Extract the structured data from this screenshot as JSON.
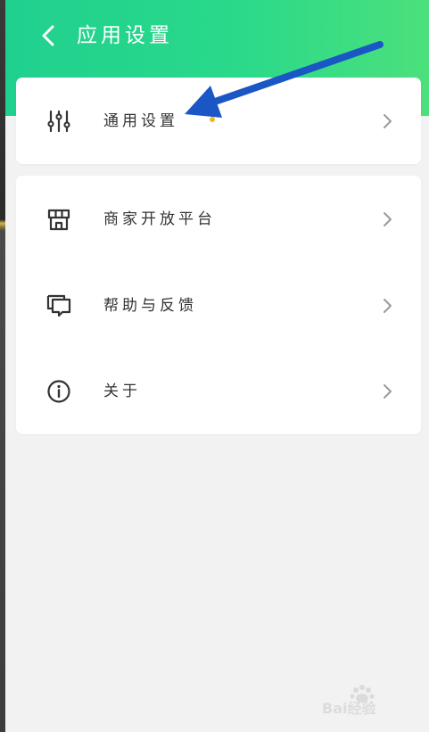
{
  "header": {
    "title": "应用设置",
    "back_icon": "chevron-left-icon",
    "gradient_start": "#20d08e",
    "gradient_end": "#4ce07c"
  },
  "settings_groups": [
    {
      "items": [
        {
          "label": "通用设置",
          "icon": "sliders-icon"
        }
      ]
    },
    {
      "items": [
        {
          "label": "商家开放平台",
          "icon": "storefront-icon"
        },
        {
          "label": "帮助与反馈",
          "icon": "chat-feedback-icon"
        },
        {
          "label": "关于",
          "icon": "info-icon"
        }
      ]
    }
  ],
  "annotation": {
    "arrow_color": "#1a56c4"
  },
  "watermark": {
    "brand": "Bai经验"
  },
  "colors": {
    "background": "#f2f2f2",
    "card": "#ffffff",
    "text": "#333333",
    "chevron": "#9a9a9a"
  }
}
